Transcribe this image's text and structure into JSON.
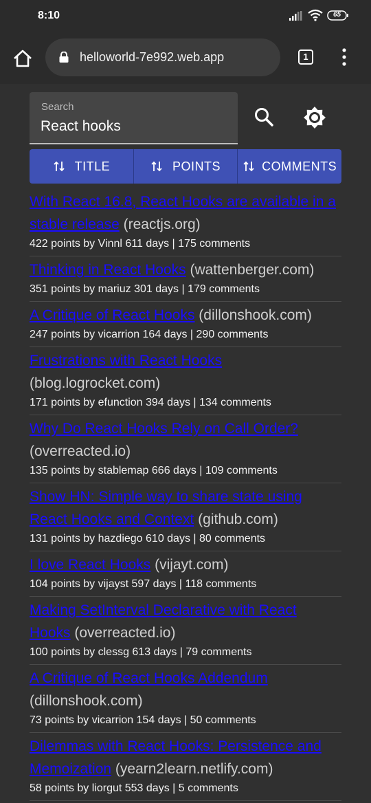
{
  "status_bar": {
    "time": "8:10",
    "battery": "65"
  },
  "browser": {
    "url": "helloworld-7e992.web.app",
    "tab_count": "1"
  },
  "search": {
    "label": "Search",
    "value": "React hooks"
  },
  "sort_buttons": [
    {
      "label": "TITLE"
    },
    {
      "label": "POINTS"
    },
    {
      "label": "COMMENTS"
    }
  ],
  "results": [
    {
      "title": "With React 16.8, React Hooks are available in a stable release",
      "domain": "(reactjs.org)",
      "meta": "422 points by Vinnl 611 days | 175 comments"
    },
    {
      "title": "Thinking in React Hooks",
      "domain": "(wattenberger.com)",
      "meta": "351 points by mariuz 301 days | 179 comments"
    },
    {
      "title": "A Critique of React Hooks",
      "domain": "(dillonshook.com)",
      "meta": "247 points by vicarrion 164 days | 290 comments"
    },
    {
      "title": "Frustrations with React Hooks",
      "domain": "(blog.logrocket.com)",
      "meta": "171 points by efunction 394 days | 134 comments"
    },
    {
      "title": "Why Do React Hooks Rely on Call Order?",
      "domain": "(overreacted.io)",
      "meta": "135 points by stablemap 666 days | 109 comments"
    },
    {
      "title": "Show HN: Simple way to share state using React Hooks and Context",
      "domain": "(github.com)",
      "meta": "131 points by hazdiego 610 days | 80 comments"
    },
    {
      "title": "I love React Hooks",
      "domain": "(vijayt.com)",
      "meta": "104 points by vijayst 597 days | 118 comments"
    },
    {
      "title": "Making SetInterval Declarative with React Hooks",
      "domain": "(overreacted.io)",
      "meta": "100 points by clessg 613 days | 79 comments"
    },
    {
      "title": "A Critique of React Hooks Addendum",
      "domain": "(dillonshook.com)",
      "meta": "73 points by vicarrion 154 days | 50 comments"
    },
    {
      "title": "Dilemmas with React Hooks: Persistence and Memoization",
      "domain": "(yearn2learn.netlify.com)",
      "meta": "58 points by liorgut 553 days | 5 comments"
    }
  ]
}
